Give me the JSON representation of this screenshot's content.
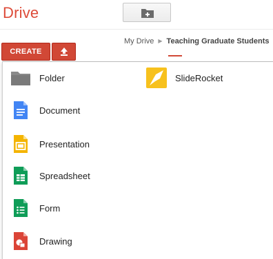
{
  "app": {
    "title": "Drive"
  },
  "toolbar": {
    "new_folder_icon": "folder-plus-icon"
  },
  "actions": {
    "create_label": "CREATE",
    "upload_icon": "upload-icon"
  },
  "breadcrumb": {
    "root": "My Drive",
    "current": "Teaching Graduate Students"
  },
  "create_menu": {
    "items": [
      {
        "label": "Folder",
        "icon": "folder-icon",
        "color": "#8a8a8a"
      },
      {
        "label": "Document",
        "icon": "document-icon",
        "color": "#4285f4"
      },
      {
        "label": "Presentation",
        "icon": "presentation-icon",
        "color": "#f4b400"
      },
      {
        "label": "Spreadsheet",
        "icon": "spreadsheet-icon",
        "color": "#0f9d58"
      },
      {
        "label": "Form",
        "icon": "form-icon",
        "color": "#0f9d58"
      },
      {
        "label": "Drawing",
        "icon": "drawing-icon",
        "color": "#db4437"
      }
    ],
    "apps": [
      {
        "label": "SlideRocket",
        "icon": "sliderocket-icon",
        "color": "#f7c11d"
      }
    ]
  }
}
